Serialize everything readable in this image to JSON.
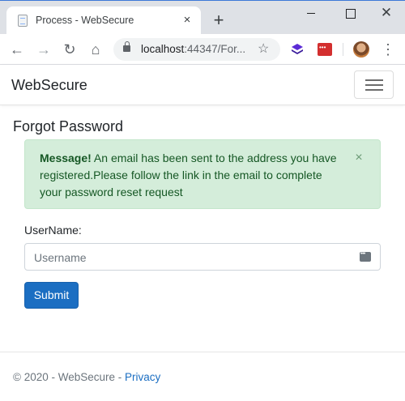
{
  "browser": {
    "tab_title": "Process - WebSecure",
    "tab_close": "×",
    "new_tab": "+",
    "url_host": "localhost",
    "url_rest": ":44347/For...",
    "close_symbol": "✕"
  },
  "navbar": {
    "brand": "WebSecure"
  },
  "page": {
    "title": "Forgot Password",
    "alert": {
      "heading": "Message!",
      "text": " An email has been sent to the address you have registered.Please follow the link in the email to complete your password reset request",
      "close": "×",
      "color": "#155724",
      "background": "#d4edda"
    },
    "form": {
      "username_label": "UserName:",
      "username_placeholder": "Username",
      "username_value": "",
      "submit_label": "Submit"
    }
  },
  "footer": {
    "copyright": "© 2020 - WebSecure - ",
    "privacy_link": "Privacy"
  },
  "colors": {
    "primary": "#1b6ec2",
    "success_text": "#155724"
  }
}
